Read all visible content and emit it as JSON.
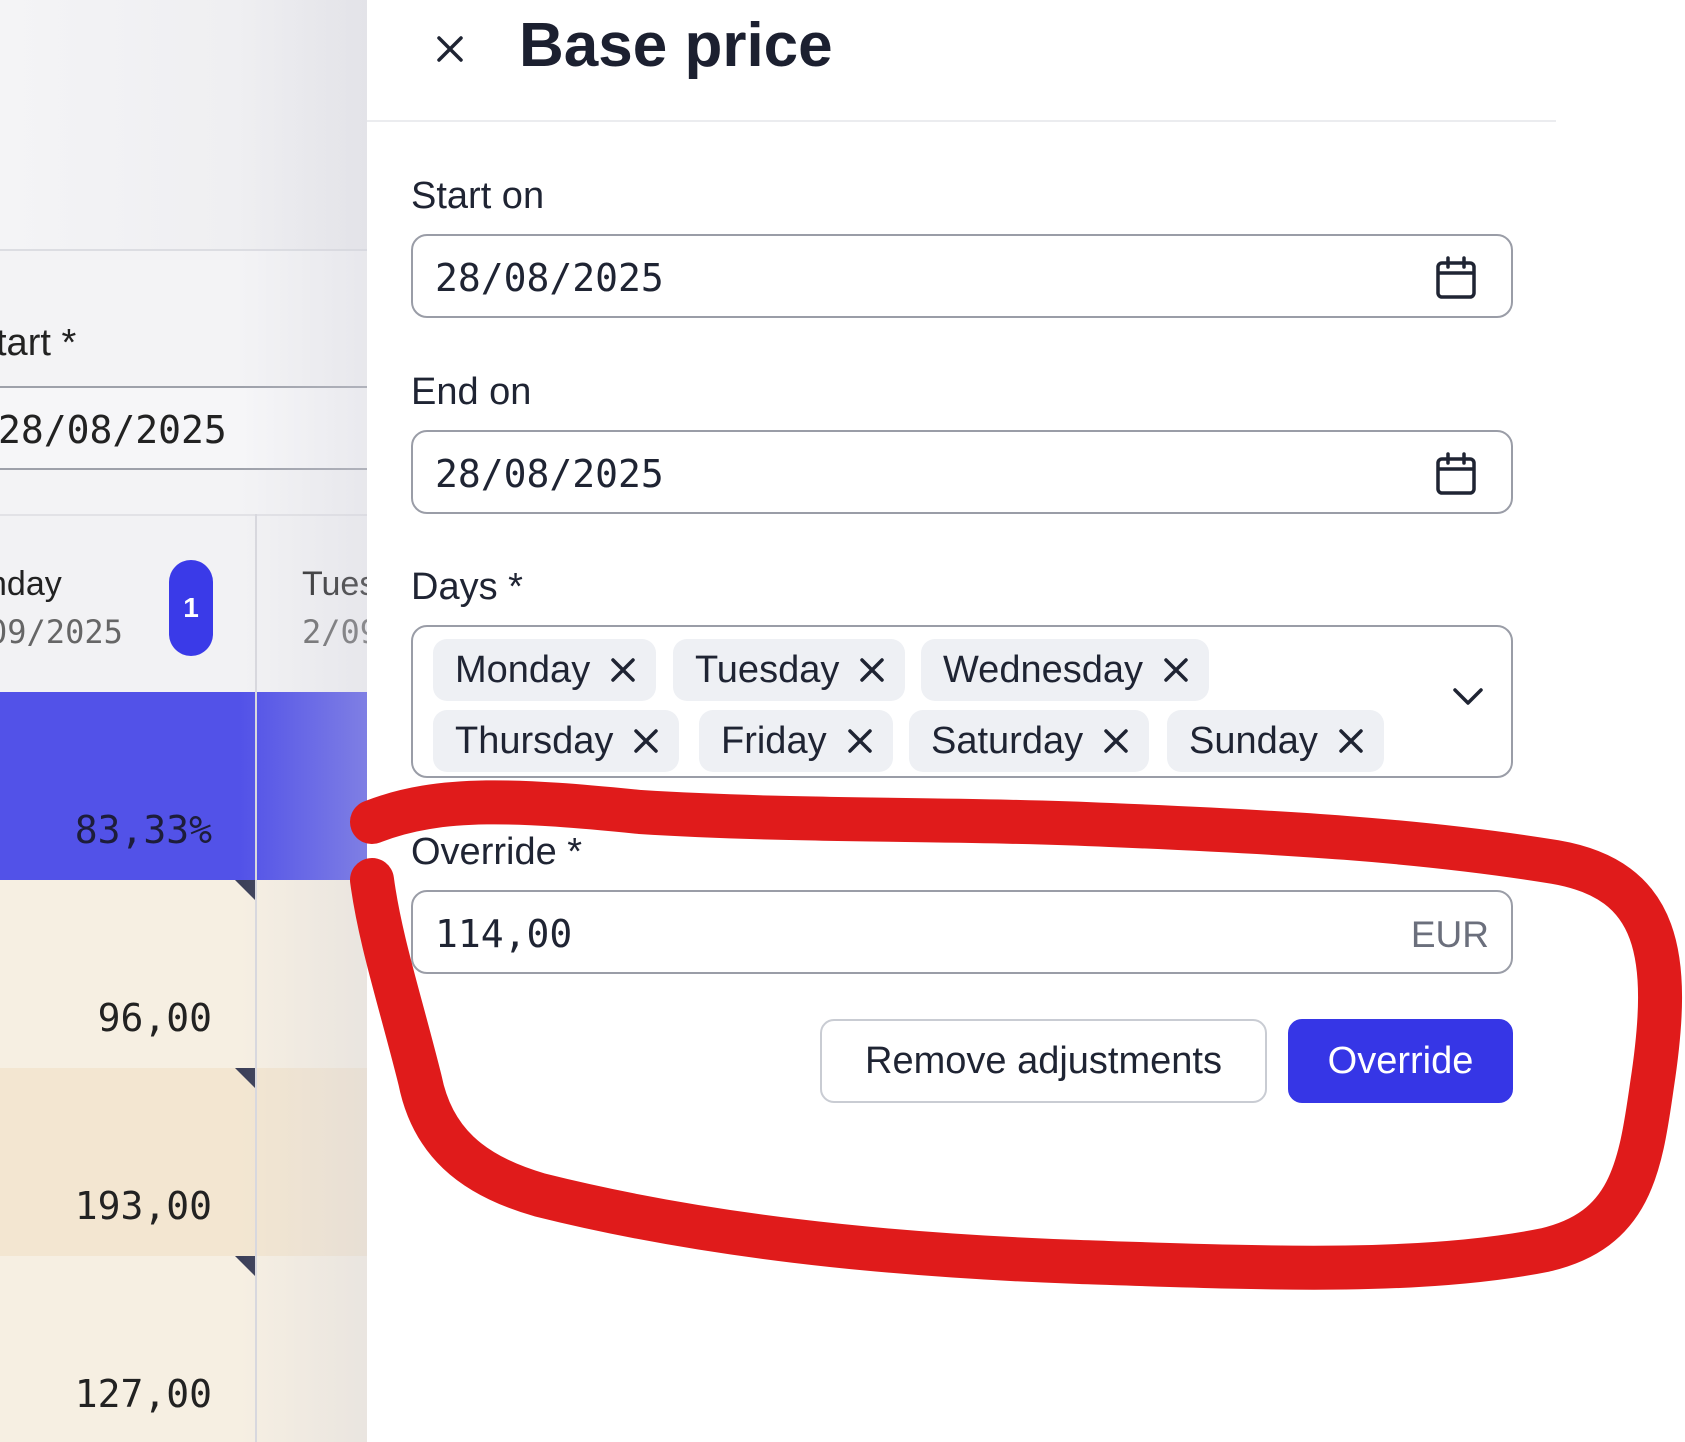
{
  "background": {
    "start_label": "tart *",
    "start_value": "28/08/2025",
    "columns": [
      {
        "day": "nday",
        "date": "09/2025",
        "badge": "1"
      },
      {
        "day": "Tues",
        "date": "2/09"
      }
    ],
    "rows": [
      {
        "value": "83,33%"
      },
      {
        "value": "96,00"
      },
      {
        "value": "193,00"
      },
      {
        "value": "127,00"
      }
    ]
  },
  "drawer": {
    "title": "Base price",
    "start_on": {
      "label": "Start on",
      "value": "28/08/2025"
    },
    "end_on": {
      "label": "End on",
      "value": "28/08/2025"
    },
    "days": {
      "label": "Days *",
      "selected": [
        "Monday",
        "Tuesday",
        "Wednesday",
        "Thursday",
        "Friday",
        "Saturday",
        "Sunday"
      ]
    },
    "override": {
      "label": "Override *",
      "value": "114,00",
      "currency": "EUR"
    },
    "buttons": {
      "remove_adjustments": "Remove adjustments",
      "override": "Override"
    }
  },
  "colors": {
    "primary": "#3636e6",
    "occupancy_row": "#5252e8",
    "price_row_light": "#f6efe2",
    "price_row_dark": "#f3e6d1",
    "annotation_red": "#e01b1b"
  }
}
